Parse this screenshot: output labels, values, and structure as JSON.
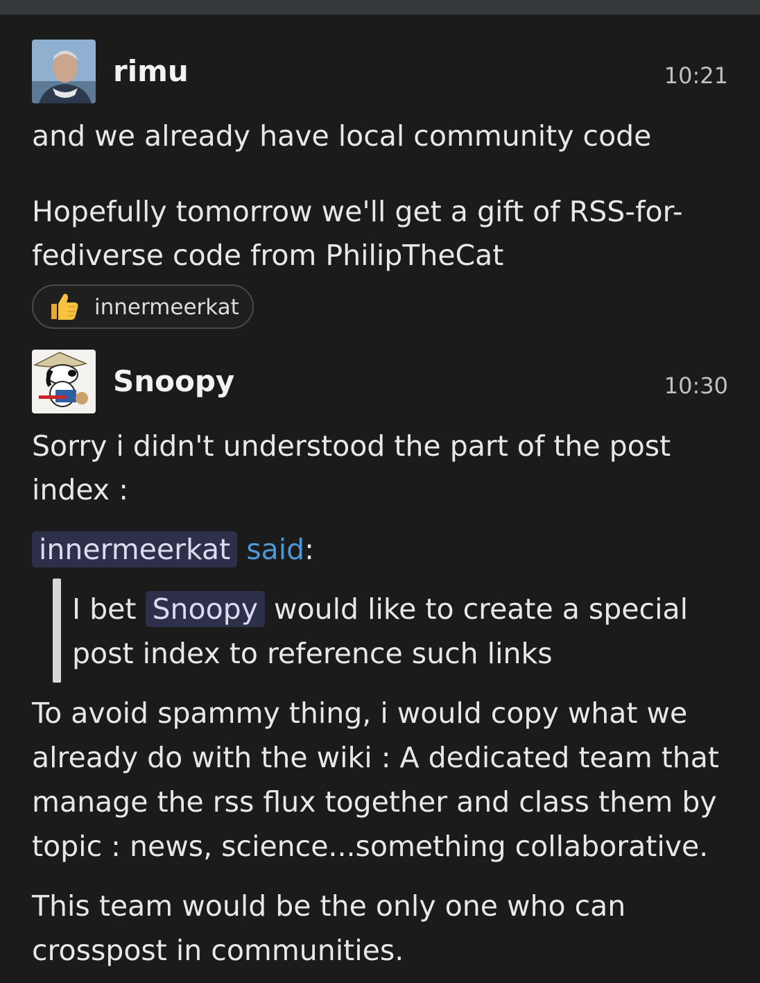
{
  "messages": [
    {
      "username": "rimu",
      "time": "10:21",
      "avatar_icon": "user-photo-avatar",
      "lines": [
        "and we already have local community code",
        "Hopefully tomorrow we'll get a gift of RSS-for-",
        "fediverse code from PhilipTheCat"
      ],
      "reaction": {
        "emoji": "thumbs-up",
        "user": "innermeerkat"
      }
    },
    {
      "username": "Snoopy",
      "time": "10:30",
      "avatar_icon": "snoopy-cartoon-avatar",
      "lines": [
        "Sorry i didn't understood the part of the post",
        "index :"
      ],
      "quote": {
        "mention": "innermeerkat",
        "said": "said",
        "colon": ":",
        "line1_before": "I bet",
        "line1_mention": "Snoopy",
        "line1_after": "would like to create a special",
        "line2": "post index to reference such links"
      },
      "after_lines": [
        "To avoid spammy thing, i would copy what we",
        "already do with the wiki : A dedicated team that",
        "manage the rss flux together and class them by",
        "topic : news, science...something collaborative.",
        "This team would be the only one who can",
        "crosspost in communities."
      ]
    }
  ]
}
